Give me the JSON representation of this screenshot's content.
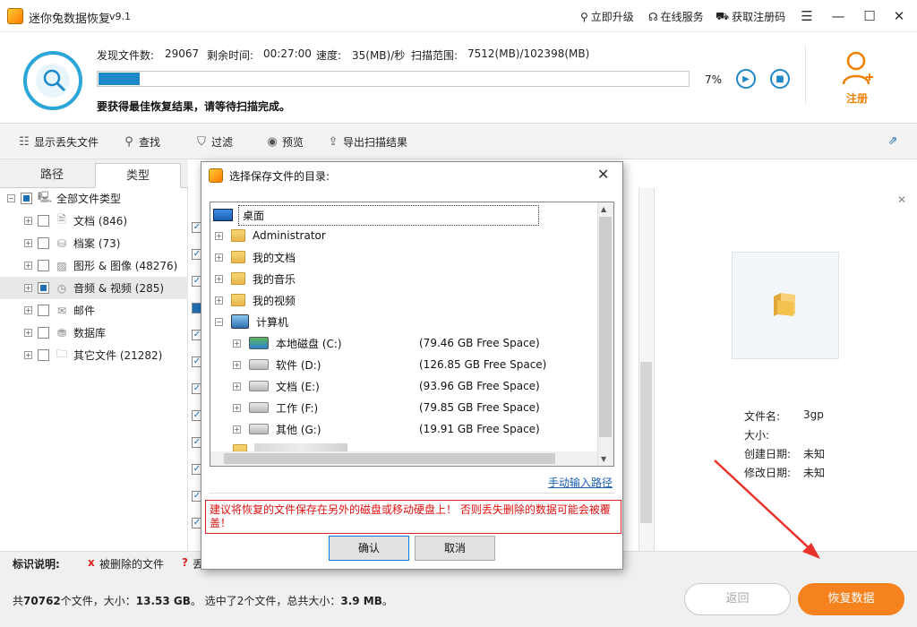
{
  "app": {
    "title": "迷你兔数据恢复",
    "version": "v9.1"
  },
  "titlebar_links": [
    "立即升级",
    "在线服务",
    "获取注册码"
  ],
  "scan": {
    "found_label": "发现文件数:",
    "found_value": "29067",
    "remain_label": "剩余时间:",
    "remain_value": "00:27:00",
    "speed_label": "速度:",
    "speed_value": "35(MB)/秒",
    "range_label": "扫描范围:",
    "range_value": "7512(MB)/102398(MB)",
    "progress_pct": 7,
    "progress_text": "7%",
    "tip": "要获得最佳恢复结果，请等待扫描完成。"
  },
  "register_label": "注册",
  "toolbar": {
    "show_lost": "显示丢失文件",
    "find": "查找",
    "filter": "过滤",
    "preview": "预览",
    "export": "导出扫描结果"
  },
  "tabs": {
    "path": "路径",
    "type": "类型"
  },
  "tree": [
    {
      "label": "全部文件类型",
      "icon": "computer-icon"
    },
    {
      "label": "文档 (846)",
      "icon": "document-icon"
    },
    {
      "label": "档案 (73)",
      "icon": "archive-icon"
    },
    {
      "label": "图形 & 图像 (48276)",
      "icon": "image-icon"
    },
    {
      "label": "音频 & 视频 (285)",
      "icon": "media-icon"
    },
    {
      "label": "邮件",
      "icon": "mail-icon"
    },
    {
      "label": "数据库",
      "icon": "database-icon"
    },
    {
      "label": "其它文件 (21282)",
      "icon": "folder-icon"
    }
  ],
  "preview": {
    "name_label": "文件名:",
    "name_value": "3gp",
    "size_label": "大小:",
    "size_value": "",
    "created_label": "创建日期:",
    "created_value": "未知",
    "modified_label": "修改日期:",
    "modified_value": "未知"
  },
  "legend": {
    "title": "标识说明:",
    "deleted": "被删除的文件",
    "lost_partial": "丢"
  },
  "summary": {
    "p1": "共",
    "count": "70762",
    "p2": "个文件，大小：",
    "size": "13.53 GB",
    "p3": "。 选中了2个文件，总共大小：",
    "sel_size": "3.9 MB",
    "p4": "。"
  },
  "buttons": {
    "back": "返回",
    "recover": "恢复数据"
  },
  "dialog": {
    "title": "选择保存文件的目录:",
    "items": {
      "desktop": "桌面",
      "admin": "Administrator",
      "docs": "我的文档",
      "music": "我的音乐",
      "video": "我的视频",
      "computer": "计算机"
    },
    "drives": [
      {
        "name": "本地磁盘 (C:)",
        "free": "(79.46 GB Free Space)"
      },
      {
        "name": "软件 (D:)",
        "free": "(126.85 GB Free Space)"
      },
      {
        "name": "文档 (E:)",
        "free": "(93.96 GB Free Space)"
      },
      {
        "name": "工作 (F:)",
        "free": "(79.85 GB Free Space)"
      },
      {
        "name": "其他 (G:)",
        "free": "(19.91 GB Free Space)"
      }
    ],
    "manual": "手动输入路径",
    "warning": "建议将恢复的文件保存在另外的磁盘或移动硬盘上！ 否则丢失删除的数据可能会被覆盖！",
    "ok": "确认",
    "cancel": "取消"
  }
}
